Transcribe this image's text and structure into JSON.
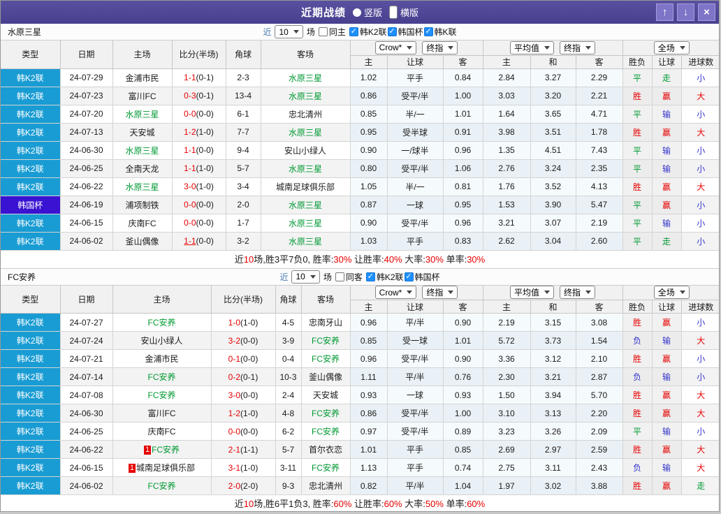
{
  "titlebar": {
    "title": "近期战绩",
    "radios": [
      {
        "label": "竖版",
        "selected": false
      },
      {
        "label": "横版",
        "selected": true
      }
    ],
    "buttons": [
      {
        "name": "move-up",
        "glyph": "↑"
      },
      {
        "name": "move-down",
        "glyph": "↓"
      },
      {
        "name": "close",
        "glyph": "×"
      }
    ]
  },
  "colors": {
    "red": "#e60000",
    "green": "#009933",
    "blue": "#3333cc",
    "focus_team": "#009933",
    "league_k2_bg": "#199cd3",
    "cup_bg": "#3912d2",
    "titlebar_purple": "#4b4397",
    "check_blue": "#1e90ff"
  },
  "table_header": {
    "cols": [
      "类型",
      "日期",
      "主场",
      "比分(半场)",
      "角球",
      "客场"
    ],
    "sub": [
      "主",
      "让球",
      "客",
      "主",
      "和",
      "客",
      "胜负",
      "让球",
      "进球数"
    ],
    "selects": {
      "book": "Crow*",
      "final1": "终指",
      "avg": "平均值",
      "final2": "终指",
      "scope": "全场"
    }
  },
  "sections": [
    {
      "team": "水原三星",
      "filter": {
        "near": "近",
        "count": "10",
        "games": "场",
        "same": "同主",
        "same_checked": false,
        "leagues": [
          {
            "label": "韩K2联",
            "checked": true
          },
          {
            "label": "韩国杯",
            "checked": true
          },
          {
            "label": "韩K联",
            "checked": true
          }
        ]
      },
      "rows": [
        {
          "type": "韩K2联",
          "cup": false,
          "date": "24-07-29",
          "home": "金浦市民",
          "home_focus": false,
          "home_card": "",
          "score": "1-1",
          "half": "(0-1)",
          "score_underline": false,
          "corner": "2-3",
          "away": "水原三星",
          "away_focus": true,
          "away_card": "",
          "odds": [
            "1.02",
            "平手",
            "0.84"
          ],
          "avg": [
            "2.84",
            "3.27",
            "2.29"
          ],
          "res": [
            [
              "平",
              "g"
            ],
            [
              "走",
              "g"
            ],
            [
              "小",
              "b"
            ]
          ]
        },
        {
          "type": "韩K2联",
          "cup": false,
          "date": "24-07-23",
          "home": "富川FC",
          "home_focus": false,
          "home_card": "",
          "score": "0-3",
          "half": "(0-1)",
          "score_underline": false,
          "corner": "13-4",
          "away": "水原三星",
          "away_focus": true,
          "away_card": "",
          "odds": [
            "0.86",
            "受平/半",
            "1.00"
          ],
          "avg": [
            "3.03",
            "3.20",
            "2.21"
          ],
          "res": [
            [
              "胜",
              "r"
            ],
            [
              "赢",
              "r"
            ],
            [
              "大",
              "r"
            ]
          ]
        },
        {
          "type": "韩K2联",
          "cup": false,
          "date": "24-07-20",
          "home": "水原三星",
          "home_focus": true,
          "home_card": "",
          "score": "0-0",
          "half": "(0-0)",
          "score_underline": false,
          "corner": "6-1",
          "away": "忠北清州",
          "away_focus": false,
          "away_card": "",
          "odds": [
            "0.85",
            "半/一",
            "1.01"
          ],
          "avg": [
            "1.64",
            "3.65",
            "4.71"
          ],
          "res": [
            [
              "平",
              "g"
            ],
            [
              "输",
              "b"
            ],
            [
              "小",
              "b"
            ]
          ]
        },
        {
          "type": "韩K2联",
          "cup": false,
          "date": "24-07-13",
          "home": "天安城",
          "home_focus": false,
          "home_card": "",
          "score": "1-2",
          "half": "(1-0)",
          "score_underline": false,
          "corner": "7-7",
          "away": "水原三星",
          "away_focus": true,
          "away_card": "",
          "odds": [
            "0.95",
            "受半球",
            "0.91"
          ],
          "avg": [
            "3.98",
            "3.51",
            "1.78"
          ],
          "res": [
            [
              "胜",
              "r"
            ],
            [
              "赢",
              "r"
            ],
            [
              "大",
              "r"
            ]
          ]
        },
        {
          "type": "韩K2联",
          "cup": false,
          "date": "24-06-30",
          "home": "水原三星",
          "home_focus": true,
          "home_card": "",
          "score": "1-1",
          "half": "(0-0)",
          "score_underline": false,
          "corner": "9-4",
          "away": "安山小绿人",
          "away_focus": false,
          "away_card": "",
          "odds": [
            "0.90",
            "一/球半",
            "0.96"
          ],
          "avg": [
            "1.35",
            "4.51",
            "7.43"
          ],
          "res": [
            [
              "平",
              "g"
            ],
            [
              "输",
              "b"
            ],
            [
              "小",
              "b"
            ]
          ]
        },
        {
          "type": "韩K2联",
          "cup": false,
          "date": "24-06-25",
          "home": "全南天龙",
          "home_focus": false,
          "home_card": "",
          "score": "1-1",
          "half": "(1-0)",
          "score_underline": false,
          "corner": "5-7",
          "away": "水原三星",
          "away_focus": true,
          "away_card": "",
          "odds": [
            "0.80",
            "受平/半",
            "1.06"
          ],
          "avg": [
            "2.76",
            "3.24",
            "2.35"
          ],
          "res": [
            [
              "平",
              "g"
            ],
            [
              "输",
              "b"
            ],
            [
              "小",
              "b"
            ]
          ]
        },
        {
          "type": "韩K2联",
          "cup": false,
          "date": "24-06-22",
          "home": "水原三星",
          "home_focus": true,
          "home_card": "",
          "score": "3-0",
          "half": "(1-0)",
          "score_underline": false,
          "corner": "3-4",
          "away": "城南足球俱乐部",
          "away_focus": false,
          "away_card": "",
          "odds": [
            "1.05",
            "半/一",
            "0.81"
          ],
          "avg": [
            "1.76",
            "3.52",
            "4.13"
          ],
          "res": [
            [
              "胜",
              "r"
            ],
            [
              "赢",
              "r"
            ],
            [
              "大",
              "r"
            ]
          ]
        },
        {
          "type": "韩国杯",
          "cup": true,
          "date": "24-06-19",
          "home": "浦项制铁",
          "home_focus": false,
          "home_card": "",
          "score": "0-0",
          "half": "(0-0)",
          "score_underline": false,
          "corner": "2-0",
          "away": "水原三星",
          "away_focus": true,
          "away_card": "",
          "odds": [
            "0.87",
            "一球",
            "0.95"
          ],
          "avg": [
            "1.53",
            "3.90",
            "5.47"
          ],
          "res": [
            [
              "平",
              "g"
            ],
            [
              "赢",
              "r"
            ],
            [
              "小",
              "b"
            ]
          ]
        },
        {
          "type": "韩K2联",
          "cup": false,
          "date": "24-06-15",
          "home": "庆南FC",
          "home_focus": false,
          "home_card": "",
          "score": "0-0",
          "half": "(0-0)",
          "score_underline": false,
          "corner": "1-7",
          "away": "水原三星",
          "away_focus": true,
          "away_card": "",
          "odds": [
            "0.90",
            "受平/半",
            "0.96"
          ],
          "avg": [
            "3.21",
            "3.07",
            "2.19"
          ],
          "res": [
            [
              "平",
              "g"
            ],
            [
              "输",
              "b"
            ],
            [
              "小",
              "b"
            ]
          ]
        },
        {
          "type": "韩K2联",
          "cup": false,
          "date": "24-06-02",
          "home": "釜山偶像",
          "home_focus": false,
          "home_card": "",
          "score": "1-1",
          "half": "(0-0)",
          "score_underline": true,
          "corner": "3-2",
          "away": "水原三星",
          "away_focus": true,
          "away_card": "",
          "odds": [
            "1.03",
            "平手",
            "0.83"
          ],
          "avg": [
            "2.62",
            "3.04",
            "2.60"
          ],
          "res": [
            [
              "平",
              "g"
            ],
            [
              "走",
              "g"
            ],
            [
              "小",
              "b"
            ]
          ]
        }
      ],
      "summary": [
        [
          "近",
          "k"
        ],
        [
          "10",
          "r"
        ],
        [
          "场,胜3平7负0, 胜率:",
          "k"
        ],
        [
          "30%",
          "r"
        ],
        [
          " 让胜率:",
          "k"
        ],
        [
          "40%",
          "r"
        ],
        [
          " 大率:",
          "k"
        ],
        [
          "30%",
          "r"
        ],
        [
          " 单率:",
          "k"
        ],
        [
          "30%",
          "r"
        ]
      ]
    },
    {
      "team": "FC安养",
      "filter": {
        "near": "近",
        "count": "10",
        "games": "场",
        "same": "同客",
        "same_checked": false,
        "leagues": [
          {
            "label": "韩K2联",
            "checked": true
          },
          {
            "label": "韩国杯",
            "checked": true
          }
        ]
      },
      "rows": [
        {
          "type": "韩K2联",
          "cup": false,
          "date": "24-07-27",
          "home": "FC安养",
          "home_focus": true,
          "home_card": "",
          "score": "1-0",
          "half": "(1-0)",
          "score_underline": false,
          "corner": "4-5",
          "away": "忠南牙山",
          "away_focus": false,
          "away_card": "",
          "odds": [
            "0.96",
            "平/半",
            "0.90"
          ],
          "avg": [
            "2.19",
            "3.15",
            "3.08"
          ],
          "res": [
            [
              "胜",
              "r"
            ],
            [
              "赢",
              "r"
            ],
            [
              "小",
              "b"
            ]
          ]
        },
        {
          "type": "韩K2联",
          "cup": false,
          "date": "24-07-24",
          "home": "安山小绿人",
          "home_focus": false,
          "home_card": "",
          "score": "3-2",
          "half": "(0-0)",
          "score_underline": false,
          "corner": "3-9",
          "away": "FC安养",
          "away_focus": true,
          "away_card": "",
          "odds": [
            "0.85",
            "受一球",
            "1.01"
          ],
          "avg": [
            "5.72",
            "3.73",
            "1.54"
          ],
          "res": [
            [
              "负",
              "b"
            ],
            [
              "输",
              "b"
            ],
            [
              "大",
              "r"
            ]
          ]
        },
        {
          "type": "韩K2联",
          "cup": false,
          "date": "24-07-21",
          "home": "金浦市民",
          "home_focus": false,
          "home_card": "",
          "score": "0-1",
          "half": "(0-0)",
          "score_underline": false,
          "corner": "0-4",
          "away": "FC安养",
          "away_focus": true,
          "away_card": "",
          "odds": [
            "0.96",
            "受平/半",
            "0.90"
          ],
          "avg": [
            "3.36",
            "3.12",
            "2.10"
          ],
          "res": [
            [
              "胜",
              "r"
            ],
            [
              "赢",
              "r"
            ],
            [
              "小",
              "b"
            ]
          ]
        },
        {
          "type": "韩K2联",
          "cup": false,
          "date": "24-07-14",
          "home": "FC安养",
          "home_focus": true,
          "home_card": "",
          "score": "0-2",
          "half": "(0-1)",
          "score_underline": false,
          "corner": "10-3",
          "away": "釜山偶像",
          "away_focus": false,
          "away_card": "",
          "odds": [
            "1.11",
            "平/半",
            "0.76"
          ],
          "avg": [
            "2.30",
            "3.21",
            "2.87"
          ],
          "res": [
            [
              "负",
              "b"
            ],
            [
              "输",
              "b"
            ],
            [
              "小",
              "b"
            ]
          ]
        },
        {
          "type": "韩K2联",
          "cup": false,
          "date": "24-07-08",
          "home": "FC安养",
          "home_focus": true,
          "home_card": "",
          "score": "3-0",
          "half": "(0-0)",
          "score_underline": false,
          "corner": "2-4",
          "away": "天安城",
          "away_focus": false,
          "away_card": "",
          "odds": [
            "0.93",
            "一球",
            "0.93"
          ],
          "avg": [
            "1.50",
            "3.94",
            "5.70"
          ],
          "res": [
            [
              "胜",
              "r"
            ],
            [
              "赢",
              "r"
            ],
            [
              "大",
              "r"
            ]
          ]
        },
        {
          "type": "韩K2联",
          "cup": false,
          "date": "24-06-30",
          "home": "富川FC",
          "home_focus": false,
          "home_card": "",
          "score": "1-2",
          "half": "(1-0)",
          "score_underline": false,
          "corner": "4-8",
          "away": "FC安养",
          "away_focus": true,
          "away_card": "",
          "odds": [
            "0.86",
            "受平/半",
            "1.00"
          ],
          "avg": [
            "3.10",
            "3.13",
            "2.20"
          ],
          "res": [
            [
              "胜",
              "r"
            ],
            [
              "赢",
              "r"
            ],
            [
              "大",
              "r"
            ]
          ]
        },
        {
          "type": "韩K2联",
          "cup": false,
          "date": "24-06-25",
          "home": "庆南FC",
          "home_focus": false,
          "home_card": "",
          "score": "0-0",
          "half": "(0-0)",
          "score_underline": false,
          "corner": "6-2",
          "away": "FC安养",
          "away_focus": true,
          "away_card": "",
          "odds": [
            "0.97",
            "受平/半",
            "0.89"
          ],
          "avg": [
            "3.23",
            "3.26",
            "2.09"
          ],
          "res": [
            [
              "平",
              "g"
            ],
            [
              "输",
              "b"
            ],
            [
              "小",
              "b"
            ]
          ]
        },
        {
          "type": "韩K2联",
          "cup": false,
          "date": "24-06-22",
          "home": "FC安养",
          "home_focus": true,
          "home_card": "1",
          "score": "2-1",
          "half": "(1-1)",
          "score_underline": false,
          "corner": "5-7",
          "away": "首尔衣恋",
          "away_focus": false,
          "away_card": "",
          "odds": [
            "1.01",
            "平手",
            "0.85"
          ],
          "avg": [
            "2.69",
            "2.97",
            "2.59"
          ],
          "res": [
            [
              "胜",
              "r"
            ],
            [
              "赢",
              "r"
            ],
            [
              "大",
              "r"
            ]
          ]
        },
        {
          "type": "韩K2联",
          "cup": false,
          "date": "24-06-15",
          "home": "城南足球俱乐部",
          "home_focus": false,
          "home_card": "1",
          "score": "3-1",
          "half": "(1-0)",
          "score_underline": false,
          "corner": "3-11",
          "away": "FC安养",
          "away_focus": true,
          "away_card": "",
          "odds": [
            "1.13",
            "平手",
            "0.74"
          ],
          "avg": [
            "2.75",
            "3.11",
            "2.43"
          ],
          "res": [
            [
              "负",
              "b"
            ],
            [
              "输",
              "b"
            ],
            [
              "大",
              "r"
            ]
          ]
        },
        {
          "type": "韩K2联",
          "cup": false,
          "date": "24-06-02",
          "home": "FC安养",
          "home_focus": true,
          "home_card": "",
          "score": "2-0",
          "half": "(2-0)",
          "score_underline": false,
          "corner": "9-3",
          "away": "忠北清州",
          "away_focus": false,
          "away_card": "",
          "odds": [
            "0.82",
            "平/半",
            "1.04"
          ],
          "avg": [
            "1.97",
            "3.02",
            "3.88"
          ],
          "res": [
            [
              "胜",
              "r"
            ],
            [
              "赢",
              "r"
            ],
            [
              "走",
              "g"
            ]
          ]
        }
      ],
      "summary": [
        [
          "近",
          "k"
        ],
        [
          "10",
          "r"
        ],
        [
          "场,胜6平1负3, 胜率:",
          "k"
        ],
        [
          "60%",
          "r"
        ],
        [
          " 让胜率:",
          "k"
        ],
        [
          "60%",
          "r"
        ],
        [
          " 大率:",
          "k"
        ],
        [
          "50%",
          "r"
        ],
        [
          " 单率:",
          "k"
        ],
        [
          "60%",
          "r"
        ]
      ]
    }
  ]
}
